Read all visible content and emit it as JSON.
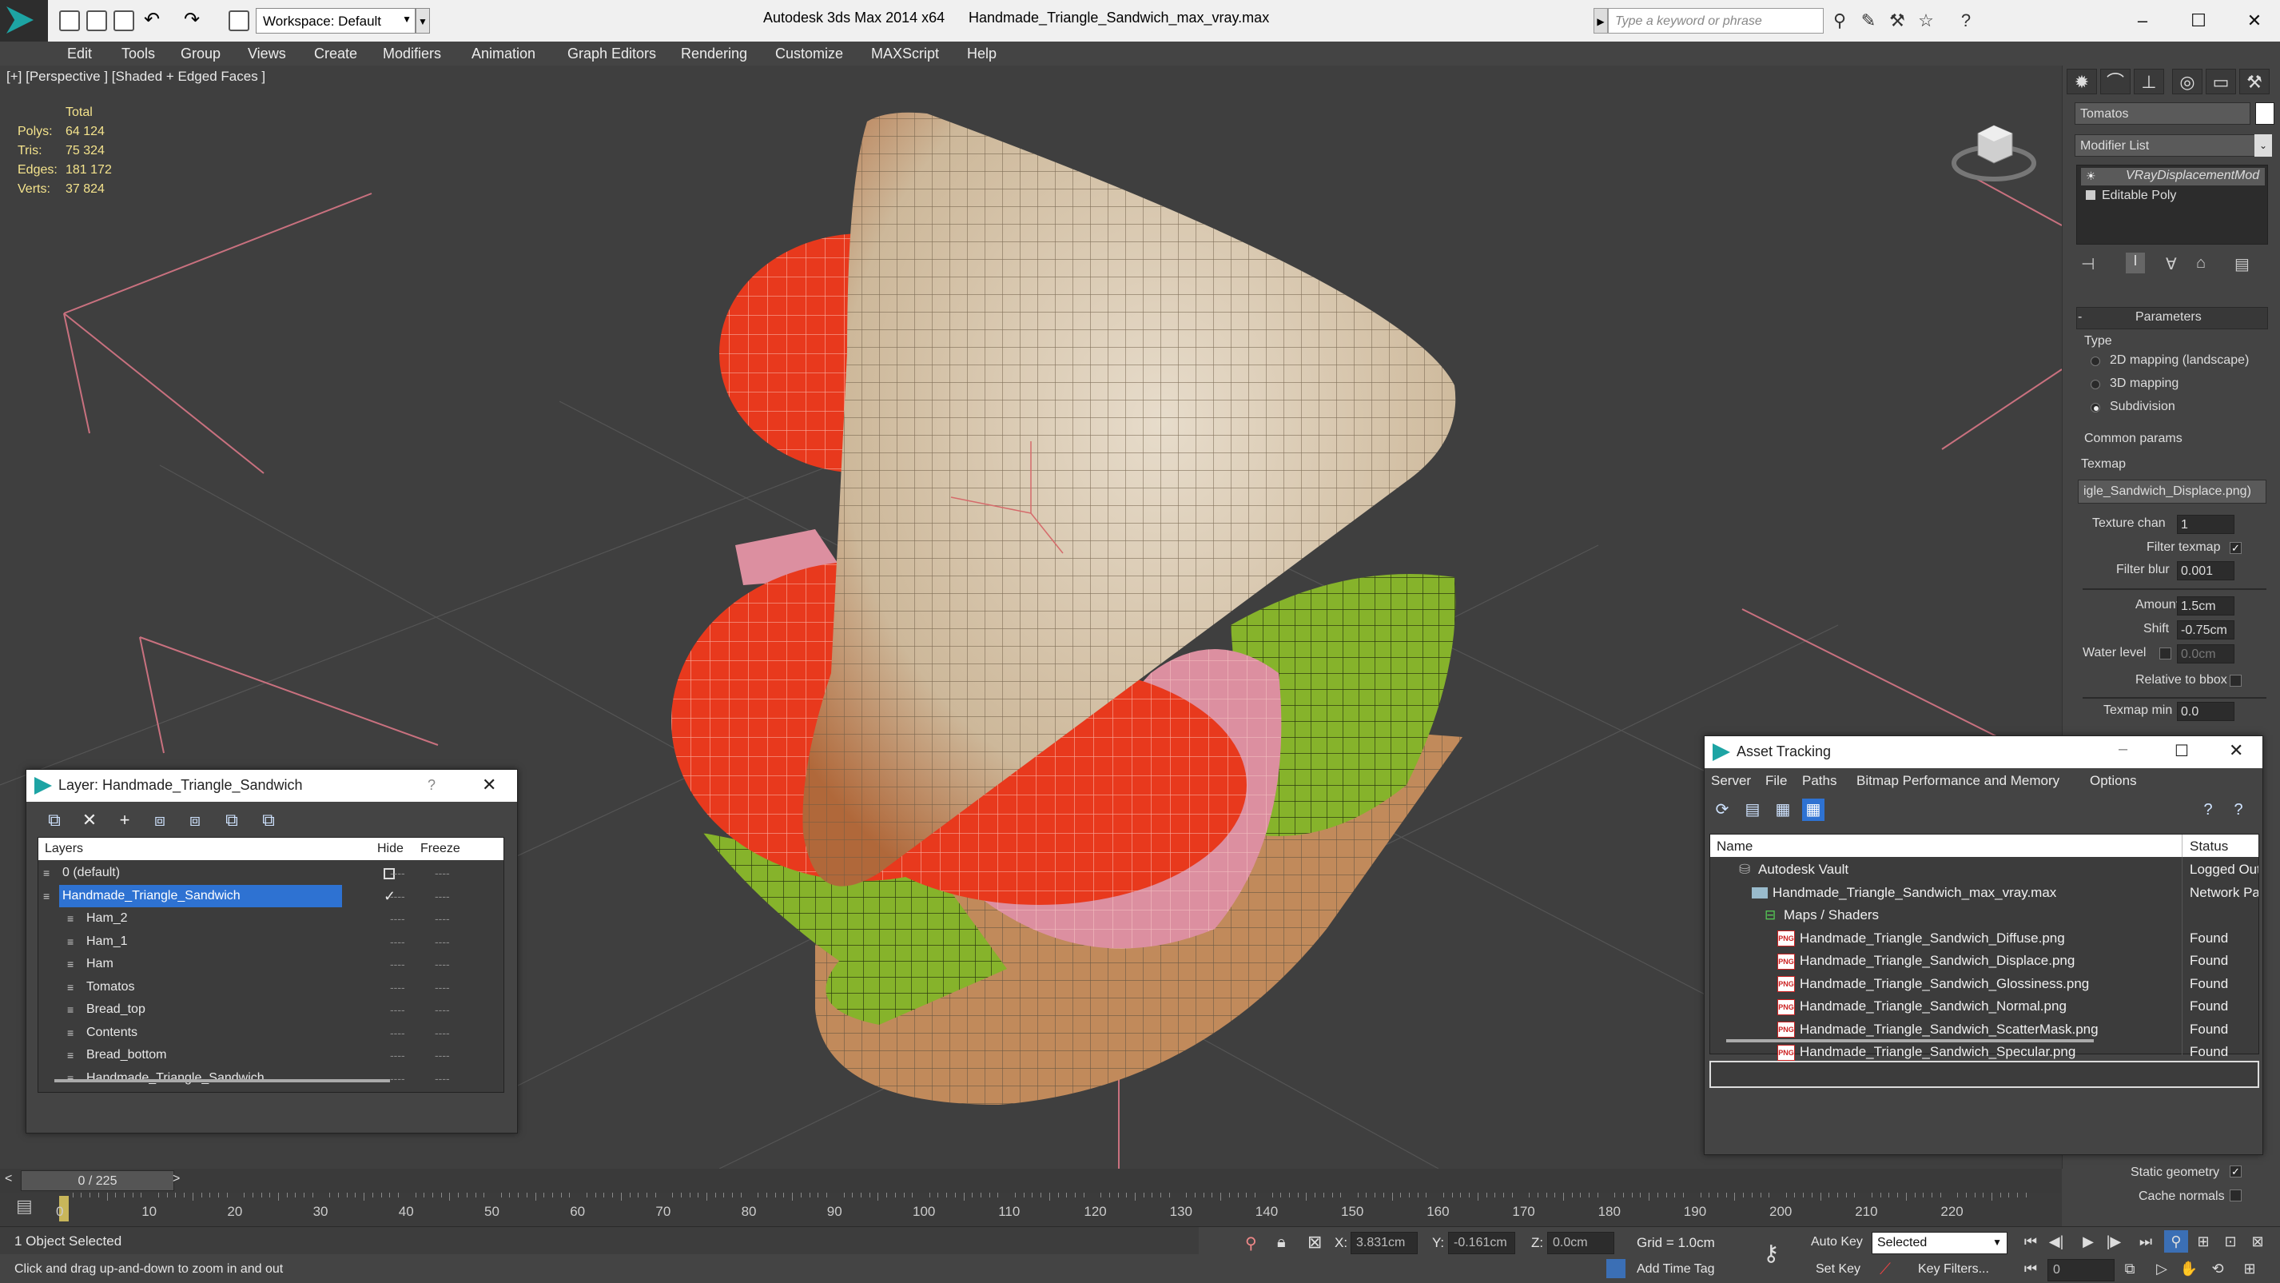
{
  "titlebar": {
    "workspace": "Workspace: Default",
    "app_title": "Autodesk 3ds Max  2014 x64",
    "file_title": "Handmade_Triangle_Sandwich_max_vray.max",
    "search_placeholder": "Type a keyword or phrase"
  },
  "menu": [
    "Edit",
    "Tools",
    "Group",
    "Views",
    "Create",
    "Modifiers",
    "Animation",
    "Graph Editors",
    "Rendering",
    "Customize",
    "MAXScript",
    "Help"
  ],
  "viewport": {
    "label": "[+] [Perspective ] [Shaded + Edged Faces ]",
    "stats_title": "Total",
    "stats": [
      {
        "label": "Polys:",
        "value": "64 124"
      },
      {
        "label": "Tris:",
        "value": "75 324"
      },
      {
        "label": "Edges:",
        "value": "181 172"
      },
      {
        "label": "Verts:",
        "value": "37 824"
      }
    ]
  },
  "command_panel": {
    "object_name": "Tomatos",
    "modifier_list": "Modifier List",
    "stack": [
      "VRayDisplacementMod",
      "Editable Poly"
    ],
    "rollout_title": "Parameters",
    "type_label": "Type",
    "type_options": [
      {
        "label": "2D mapping (landscape)",
        "selected": false
      },
      {
        "label": "3D mapping",
        "selected": false
      },
      {
        "label": "Subdivision",
        "selected": true
      }
    ],
    "common_params": "Common params",
    "texmap_label": "Texmap",
    "texmap_value": "igle_Sandwich_Displace.png)",
    "params": [
      {
        "label": "Texture chan",
        "value": "1"
      },
      {
        "label": "Filter blur",
        "value": "0.001"
      },
      {
        "label": "Amount",
        "value": "1.5cm"
      },
      {
        "label": "Shift",
        "value": "-0.75cm"
      },
      {
        "label": "Water level",
        "value": "0.0cm"
      },
      {
        "label": "Texmap min",
        "value": "0.0"
      }
    ],
    "filter_texmap": "Filter texmap",
    "relative_bbox": "Relative to bbox",
    "static_geometry": "Static geometry",
    "cache_normals": "Cache normals"
  },
  "layer_window": {
    "title": "Layer: Handmade_Triangle_Sandwich",
    "help": "?",
    "col_layers": "Layers",
    "col_hide": "Hide",
    "col_freeze": "Freeze",
    "rows": [
      {
        "name": "0 (default)",
        "indent": 0,
        "selected": false,
        "mark": "box"
      },
      {
        "name": "Handmade_Triangle_Sandwich",
        "indent": 0,
        "selected": true,
        "mark": "check"
      },
      {
        "name": "Ham_2",
        "indent": 1,
        "selected": false,
        "mark": ""
      },
      {
        "name": "Ham_1",
        "indent": 1,
        "selected": false,
        "mark": ""
      },
      {
        "name": "Ham",
        "indent": 1,
        "selected": false,
        "mark": ""
      },
      {
        "name": "Tomatos",
        "indent": 1,
        "selected": false,
        "mark": ""
      },
      {
        "name": "Bread_top",
        "indent": 1,
        "selected": false,
        "mark": ""
      },
      {
        "name": "Contents",
        "indent": 1,
        "selected": false,
        "mark": ""
      },
      {
        "name": "Bread_bottom",
        "indent": 1,
        "selected": false,
        "mark": ""
      },
      {
        "name": "Handmade_Triangle_Sandwich",
        "indent": 1,
        "selected": false,
        "mark": ""
      }
    ],
    "dash": "----"
  },
  "asset_window": {
    "title": "Asset Tracking",
    "menu": [
      "Server",
      "File",
      "Paths",
      "Bitmap Performance and Memory",
      "Options"
    ],
    "col_name": "Name",
    "col_status": "Status",
    "png_tag": "PNG",
    "rows": [
      {
        "name": "Autodesk Vault",
        "status": "Logged Out",
        "indent": 1,
        "icon": "vault"
      },
      {
        "name": "Handmade_Triangle_Sandwich_max_vray.max",
        "status": "Network Path",
        "indent": 2,
        "icon": "max"
      },
      {
        "name": "Maps / Shaders",
        "status": "",
        "indent": 3,
        "icon": "maps"
      },
      {
        "name": "Handmade_Triangle_Sandwich_Diffuse.png",
        "status": "Found",
        "indent": 4,
        "icon": "png"
      },
      {
        "name": "Handmade_Triangle_Sandwich_Displace.png",
        "status": "Found",
        "indent": 4,
        "icon": "png"
      },
      {
        "name": "Handmade_Triangle_Sandwich_Glossiness.png",
        "status": "Found",
        "indent": 4,
        "icon": "png"
      },
      {
        "name": "Handmade_Triangle_Sandwich_Normal.png",
        "status": "Found",
        "indent": 4,
        "icon": "png"
      },
      {
        "name": "Handmade_Triangle_Sandwich_ScatterMask.png",
        "status": "Found",
        "indent": 4,
        "icon": "png"
      },
      {
        "name": "Handmade_Triangle_Sandwich_Specular.png",
        "status": "Found",
        "indent": 4,
        "icon": "png"
      }
    ]
  },
  "timeline": {
    "frame": "0 / 225",
    "ticks": [
      "0",
      "10",
      "20",
      "30",
      "40",
      "50",
      "60",
      "70",
      "80",
      "90",
      "100",
      "110",
      "120",
      "130",
      "140",
      "150",
      "160",
      "170",
      "180",
      "190",
      "200",
      "210",
      "220"
    ]
  },
  "status": {
    "selection": "1 Object Selected",
    "prompt": "Click and drag up-and-down to zoom in and out",
    "x_label": "X:",
    "x_value": "3.831cm",
    "y_label": "Y:",
    "y_value": "-0.161cm",
    "z_label": "Z:",
    "z_value": "0.0cm",
    "grid": "Grid = 1.0cm",
    "add_time_tag": "Add Time Tag",
    "auto_key": "Auto Key",
    "set_key": "Set Key",
    "selected": "Selected",
    "key_filters": "Key Filters...",
    "frame_field": "0"
  },
  "colors": {
    "viewport_bg": "#3f3f3f",
    "selection_blue": "#2e72d2",
    "stats_yellow": "#f4e38c",
    "tomato": "#e8391d",
    "bread": "#c9b69a",
    "lettuce": "#7fb02d",
    "ham": "#d88a9a"
  }
}
